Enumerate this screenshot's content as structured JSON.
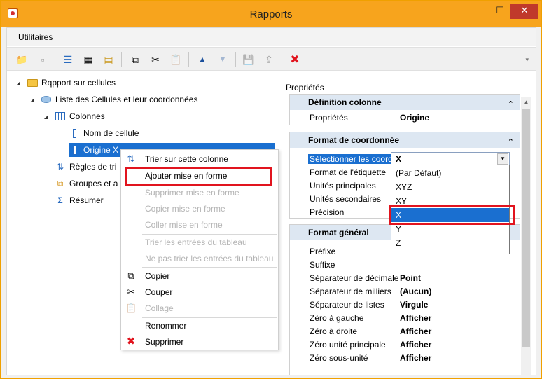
{
  "window": {
    "title": "Rapports",
    "min": "—",
    "max": "☐",
    "close": "✕"
  },
  "menubar": {
    "items": [
      "Utilitaires"
    ]
  },
  "toolbar": {
    "buttons": [
      {
        "icon": "add-folder-icon",
        "glyph": "📁"
      },
      {
        "icon": "page-icon",
        "glyph": "▫"
      },
      {
        "icon": "list-icon",
        "glyph": "☰"
      },
      {
        "icon": "grid-icon",
        "glyph": "▦"
      },
      {
        "icon": "filter-icon",
        "glyph": "▤"
      },
      {
        "icon": "copy-icon",
        "glyph": "⧉"
      },
      {
        "icon": "cut-icon",
        "glyph": "✂"
      },
      {
        "icon": "paste-icon",
        "glyph": "📋"
      },
      {
        "icon": "arrow-up-icon",
        "glyph": "▲"
      },
      {
        "icon": "arrow-down-icon",
        "glyph": "▼"
      },
      {
        "icon": "save-icon",
        "glyph": "💾"
      },
      {
        "icon": "export-icon",
        "glyph": "⇪"
      },
      {
        "icon": "delete-icon",
        "glyph": "✖"
      }
    ]
  },
  "tree": {
    "root": "Rqpport sur cellules",
    "list": "Liste des Cellules et leur coordonnées",
    "columns": "Colonnes",
    "col_name": "Nom de cellule",
    "col_origin": "Origine X",
    "rules": "Règles de tri",
    "groups": "Groupes et a",
    "summary": "Résumer"
  },
  "context_menu": {
    "sort_column": "Trier sur cette colonne",
    "add_format": "Ajouter mise en forme",
    "delete_format": "Supprimer mise en forme",
    "copy_format": "Copier mise en forme",
    "paste_format": "Coller mise en forme",
    "sort_entries": "Trier les entrées du tableau",
    "no_sort_entries": "Ne pas trier les entrées du tableau",
    "copy": "Copier",
    "cut": "Couper",
    "paste": "Collage",
    "rename": "Renommer",
    "delete": "Supprimer"
  },
  "properties": {
    "title": "Propriétés",
    "section_definition": "Définition colonne",
    "def_rows": [
      {
        "name": "Propriétés",
        "value": "Origine"
      }
    ],
    "section_coord": "Format de coordonnée",
    "coord_rows": [
      {
        "name": "Sélectionner les coordo",
        "value": "X"
      },
      {
        "name": "Format de l'étiquette",
        "value": ""
      },
      {
        "name": "Unités principales",
        "value": ""
      },
      {
        "name": "Unités secondaires",
        "value": ""
      },
      {
        "name": "Précision",
        "value": ""
      }
    ],
    "section_general": "Format général",
    "general_rows": [
      {
        "name": "Préfixe",
        "value": ""
      },
      {
        "name": "Suffixe",
        "value": ""
      },
      {
        "name": "Séparateur de décimales",
        "value": "Point"
      },
      {
        "name": "Séparateur de milliers",
        "value": "(Aucun)"
      },
      {
        "name": "Séparateur de listes",
        "value": "Virgule"
      },
      {
        "name": "Zéro à gauche",
        "value": "Afficher"
      },
      {
        "name": "Zéro à droite",
        "value": "Afficher"
      },
      {
        "name": "Zéro unité principale",
        "value": "Afficher"
      },
      {
        "name": "Zéro sous-unité",
        "value": "Afficher"
      }
    ]
  },
  "dropdown": {
    "value": "X",
    "options": [
      "(Par Défaut)",
      "XYZ",
      "XY",
      "X",
      "Y",
      "Z"
    ],
    "highlighted": "X"
  },
  "colors": {
    "highlight": "#1a6fd0",
    "annotation": "#e1141e",
    "titlebar": "#f7a41d"
  }
}
